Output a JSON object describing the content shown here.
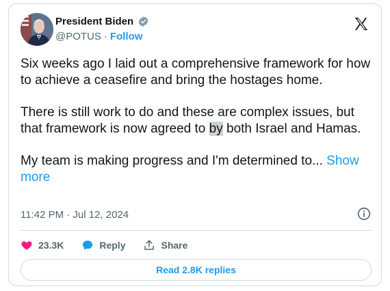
{
  "author": {
    "name": "President Biden",
    "handle": "@POTUS",
    "separator": "·",
    "follow_label": "Follow"
  },
  "post": {
    "paragraph1": "Six weeks ago I laid out a comprehensive framework for how to achieve a ceasefire and bring the hostages home.",
    "paragraph2_before": "There is still work to do and these are complex issues, but that framework is now agreed to ",
    "paragraph2_highlight": "by",
    "paragraph2_after": " both Israel and Hamas.",
    "paragraph3": "My team is making progress and I'm determined to...",
    "show_more_label": "Show more"
  },
  "meta": {
    "timestamp": "11:42 PM · Jul 12, 2024"
  },
  "actions": {
    "likes": "23.3K",
    "reply_label": "Reply",
    "share_label": "Share"
  },
  "read_replies_label": "Read 2.8K replies",
  "colors": {
    "accent": "#1d9bf0",
    "like": "#f91880",
    "text": "#0f1419",
    "muted": "#536471",
    "border": "#cfd9de"
  },
  "icons": [
    "verified-badge-icon",
    "x-logo-icon",
    "info-icon",
    "heart-icon",
    "reply-bubble-icon",
    "share-icon"
  ]
}
